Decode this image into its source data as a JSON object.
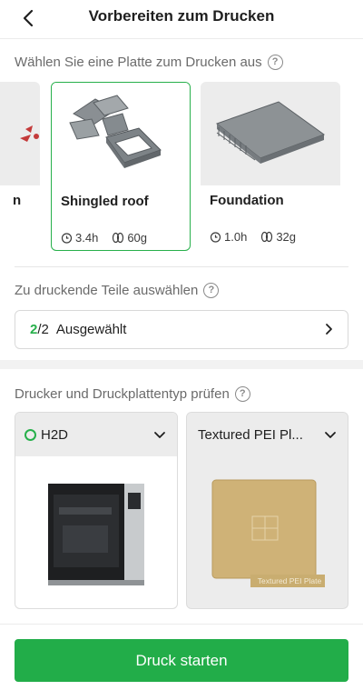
{
  "header": {
    "title": "Vorbereiten zum Drucken"
  },
  "plates": {
    "label": "Wählen Sie eine Platte zum Drucken aus",
    "items": [
      {
        "name": "n"
      },
      {
        "name": "Shingled roof",
        "time": "3.4h",
        "weight": "60g",
        "selected": true
      },
      {
        "name": "Foundation",
        "time": "1.0h",
        "weight": "32g",
        "selected": false
      }
    ]
  },
  "parts": {
    "label": "Zu druckende Teile auswählen",
    "count_selected": "2",
    "count_total": "/2",
    "status": "Ausgewählt"
  },
  "printer_section": {
    "label": "Drucker und Druckplattentyp prüfen",
    "printer": {
      "name": "H2D",
      "status_color": "#27b04b"
    },
    "plate_type": {
      "name": "Textured PEI Pl...",
      "image_caption": "Textured PEI Plate"
    }
  },
  "actions": {
    "start_label": "Druck starten"
  },
  "colors": {
    "accent": "#22ad49",
    "selected_border": "#27b04b"
  },
  "icons": [
    "back-arrow-icon",
    "help-icon",
    "clock-icon",
    "filament-icon",
    "chevron-right-icon",
    "chevron-down-icon"
  ]
}
